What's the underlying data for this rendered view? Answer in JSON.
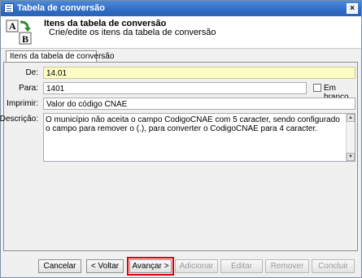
{
  "window": {
    "title": "Tabela de conversão",
    "close_label": "×"
  },
  "header": {
    "title": "Itens da tabela de conversão",
    "subtitle": "Crie/edite os itens da tabela de conversão",
    "logo_letters": [
      "A",
      "B"
    ]
  },
  "tab": {
    "label": "Itens da tabela de conversão"
  },
  "form": {
    "de": {
      "label": "De:",
      "value": "14.01"
    },
    "para": {
      "label": "Para:",
      "value": "1401"
    },
    "em_branco": {
      "label": "Em branco",
      "checked": false
    },
    "imprimir": {
      "label": "Imprimir:",
      "value": "Valor do código CNAE"
    },
    "descricao": {
      "label": "Descrição:",
      "value": "O município não aceita o campo CodigoCNAE com 5 caracter, sendo configurado o campo para remover o (.), para converter o CodigoCNAE para 4 caracter."
    }
  },
  "footer": {
    "cancelar": "Cancelar",
    "voltar": "< Voltar",
    "avancar": "Avançar >",
    "adicionar": "Adicionar",
    "editar": "Editar",
    "remover": "Remover",
    "concluir": "Concluir"
  },
  "colors": {
    "titlebar": "#2f6bc4",
    "highlight": "#e00000",
    "required_field": "#fcfcc4"
  }
}
